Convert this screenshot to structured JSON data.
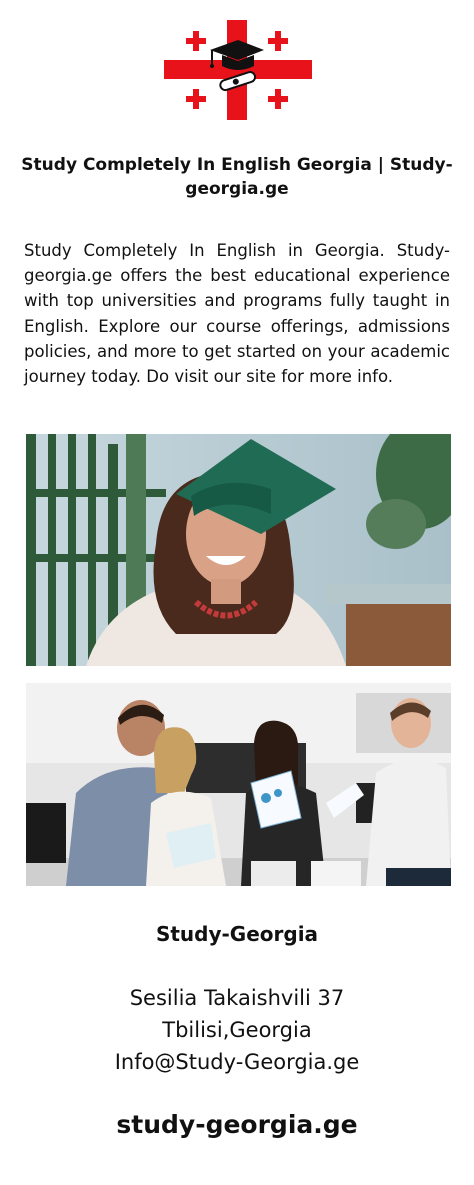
{
  "brand_color": "#e8121b",
  "header": {
    "logo_icon": "georgian-cross-graduation-cap-logo",
    "title": "Study Completely In English Georgia | Study-georgia.ge"
  },
  "body": {
    "description": "Study Completely In English in Georgia. Study-georgia.ge offers the best educational experience with top universities and programs fully taught in English. Explore our course offerings, admissions policies, and more to get started on your academic journey today. Do visit our site for more info."
  },
  "photos": [
    {
      "icon": "graduate-photo"
    },
    {
      "icon": "office-team-meeting-photo"
    }
  ],
  "contact": {
    "name": "Study-Georgia",
    "address_line1": "Sesilia Takaishvili 37",
    "address_line2": "Tbilisi,Georgia",
    "email": "Info@Study-Georgia.ge"
  },
  "footer": {
    "website": "study-georgia.ge"
  }
}
